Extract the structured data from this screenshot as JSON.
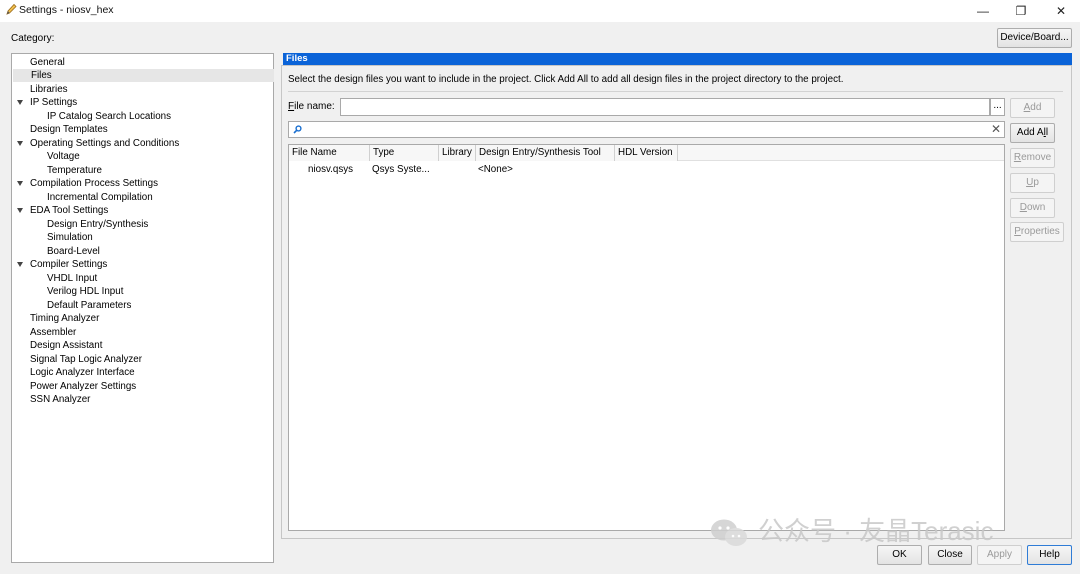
{
  "window": {
    "title": "Settings - niosv_hex",
    "minimize": "—",
    "restore": "❐",
    "close": "✕"
  },
  "category_label": "Category:",
  "device_board_button": "Device/Board...",
  "tree": {
    "general": "General",
    "files": "Files",
    "libraries": "Libraries",
    "ip_settings": "IP Settings",
    "ip_catalog": "IP Catalog Search Locations",
    "design_templates": "Design Templates",
    "operating": "Operating Settings and Conditions",
    "voltage": "Voltage",
    "temperature": "Temperature",
    "compilation": "Compilation Process Settings",
    "incremental": "Incremental Compilation",
    "eda": "EDA Tool Settings",
    "design_entry": "Design Entry/Synthesis",
    "simulation": "Simulation",
    "board_level": "Board-Level",
    "compiler": "Compiler Settings",
    "vhdl": "VHDL Input",
    "verilog": "Verilog HDL Input",
    "default_params": "Default Parameters",
    "timing": "Timing Analyzer",
    "assembler": "Assembler",
    "design_assistant": "Design Assistant",
    "signal_tap": "Signal Tap Logic Analyzer",
    "logic_analyzer": "Logic Analyzer Interface",
    "power": "Power Analyzer Settings",
    "ssn": "SSN Analyzer"
  },
  "panel": {
    "header": "Files",
    "instructions": "Select the design files you want to include in the project. Click Add All to add all design files in the project directory to the project.",
    "file_name_first": "F",
    "file_name_rest": "ile name:",
    "file_name_value": "",
    "browse": "...",
    "search_value": ""
  },
  "table": {
    "columns": [
      "File Name",
      "Type",
      "Library",
      "Design Entry/Synthesis Tool",
      "HDL Version"
    ],
    "rows": [
      [
        "niosv.qsys",
        "Qsys Syste...",
        "",
        "<None>",
        ""
      ]
    ]
  },
  "side_buttons": {
    "add_first": "A",
    "add_rest": "dd",
    "addall_a": "Add A",
    "addall_l": "l",
    "addall_rest": "l",
    "remove_first": "R",
    "remove_rest": "emove",
    "up_first": "U",
    "up_rest": "p",
    "down_first": "D",
    "down_rest": "own",
    "properties_first": "P",
    "properties_rest": "roperties"
  },
  "footer": {
    "ok": "OK",
    "close": "Close",
    "apply": "Apply",
    "help": "Help"
  },
  "watermark": "公众号 · 友晶Terasic"
}
